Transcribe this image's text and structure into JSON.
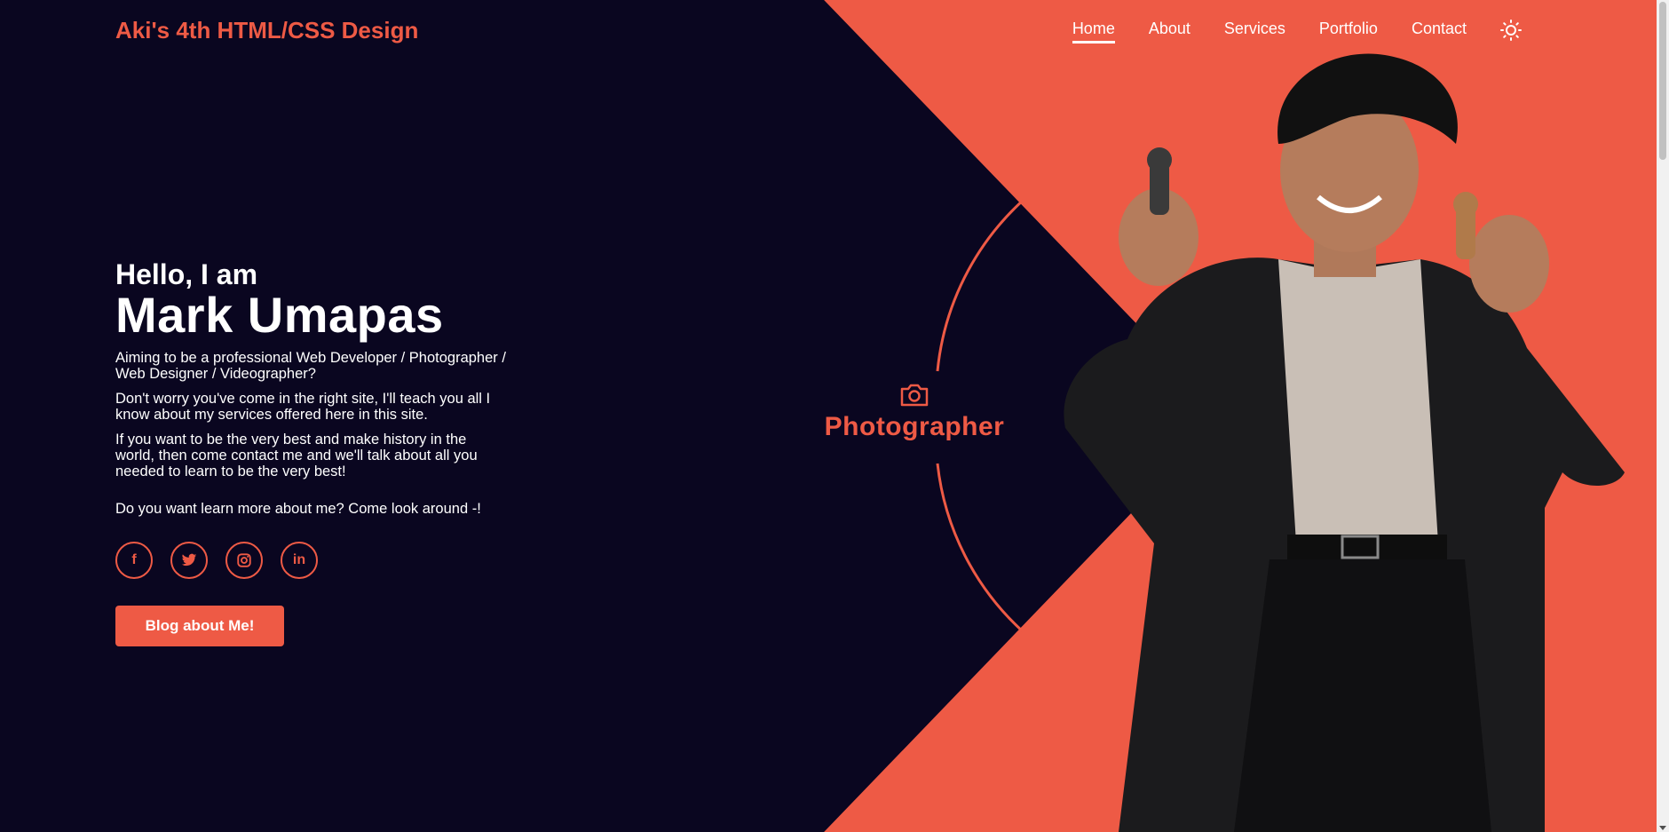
{
  "header": {
    "logo": "Aki's 4th HTML/CSS Design",
    "nav": [
      {
        "label": "Home",
        "active": true
      },
      {
        "label": "About"
      },
      {
        "label": "Services"
      },
      {
        "label": "Portfolio"
      },
      {
        "label": "Contact"
      }
    ],
    "theme_icon": "sun-icon"
  },
  "intro": {
    "greeting": "Hello, I am",
    "name": "Mark Umapas",
    "line1": "Aiming to be a professional Web Developer / Photographer / Web Designer / Videographer?",
    "line2": "Don't worry you've come in the right site, I'll teach you all I know about my services offered here in this site.",
    "line3": "If you want to be the very best and make history in the world, then come contact me and we'll talk about all you needed to learn to be the very best!",
    "line4": "Do you want learn more about me? Come look around -!",
    "socials": [
      {
        "icon": "facebook-icon",
        "glyph": "f"
      },
      {
        "icon": "twitter-icon"
      },
      {
        "icon": "instagram-icon"
      },
      {
        "icon": "linkedin-icon",
        "glyph": "in"
      }
    ],
    "cta_label": "Blog about Me!"
  },
  "role": {
    "icon": "camera-icon",
    "label": "Photographer"
  },
  "colors": {
    "background": "#0a0620",
    "accent": "#ee5a45",
    "text": "#ffffff"
  }
}
